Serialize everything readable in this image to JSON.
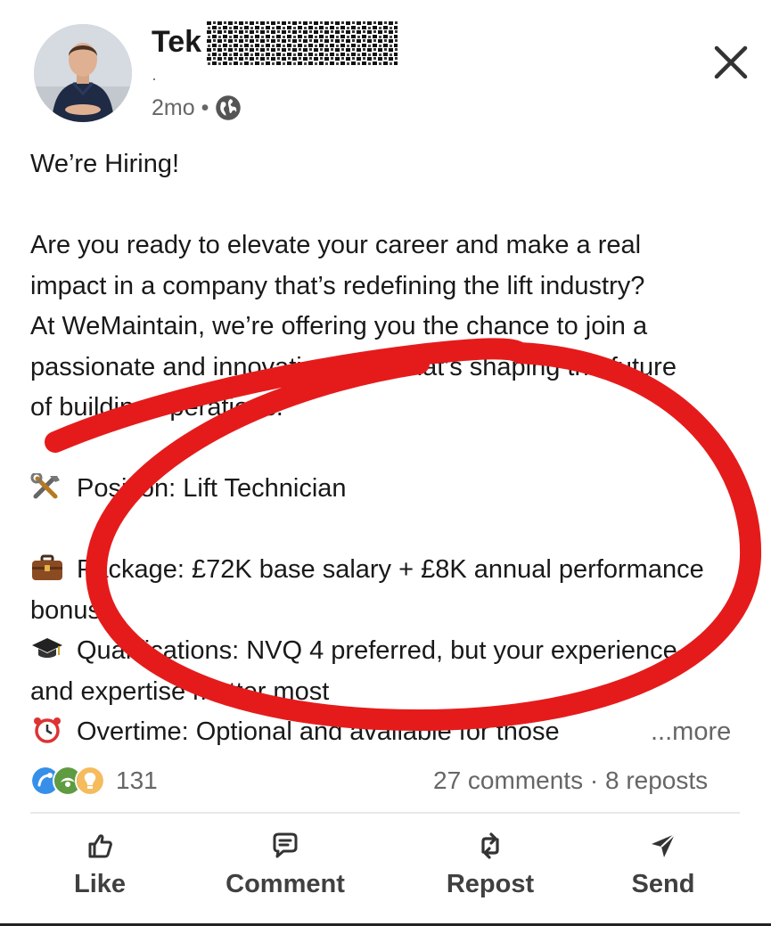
{
  "author": {
    "name": "Tek",
    "sub": "·",
    "time": "2mo",
    "separator": "•",
    "visibility_icon": "globe-icon"
  },
  "post": {
    "headline": "We’re Hiring!",
    "paragraph": [
      "Are you ready to elevate your career and make a real",
      "impact in a company that’s redefining the lift industry?",
      "At WeMaintain, we’re offering you the chance to join a",
      "passionate and innovative team that’s shaping the future",
      "of building operations."
    ],
    "position": "Position: Lift Technician",
    "package_line1": "Package: £72K base salary + £8K annual performance",
    "package_line2": "bonus!",
    "qualifications_line1": "Qualifications: NVQ 4 preferred, but your experience",
    "qualifications_line2": "and expertise matter most",
    "overtime": "Overtime: Optional and available for those",
    "more": "...more"
  },
  "stats": {
    "reaction_icons": [
      "celebrate-icon",
      "support-icon",
      "insightful-icon"
    ],
    "reactions": "131",
    "comments": "27 comments",
    "separator": "·",
    "reposts": "8 reposts"
  },
  "actions": {
    "like": "Like",
    "comment": "Comment",
    "repost": "Repost",
    "send": "Send"
  },
  "colors": {
    "annotation": "#e51b1b",
    "muted_text": "#666666",
    "celebrate": "#378fe9",
    "support": "#5f9b41",
    "insightful": "#f5bb5c"
  }
}
